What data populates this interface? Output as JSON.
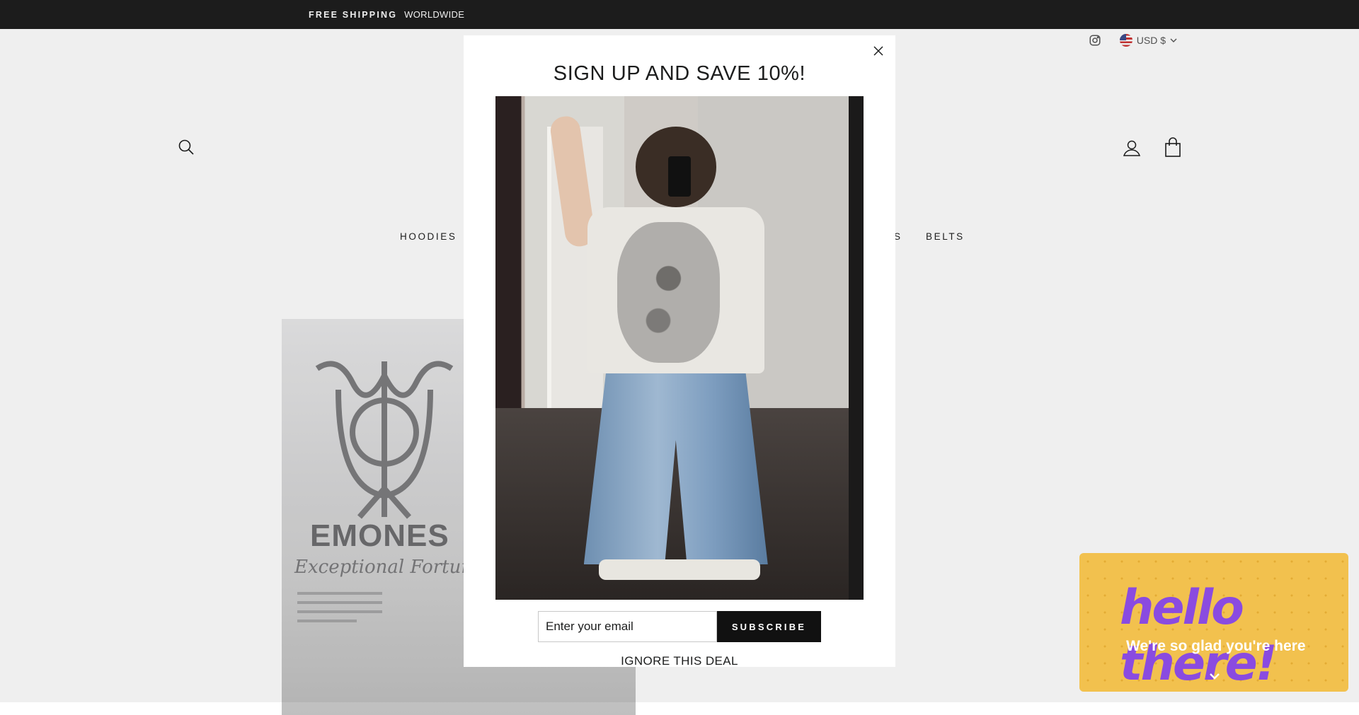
{
  "announcement": {
    "strong": "FREE SHIPPING",
    "light": "WORLDWIDE"
  },
  "utility": {
    "currency": "USD $"
  },
  "nav": [
    {
      "label": "HOODIES"
    },
    {
      "label": "S"
    },
    {
      "label": "BELTS"
    }
  ],
  "hero": {
    "brand": "EMONES",
    "tagline": "Exceptional Fortunes"
  },
  "modal": {
    "title": "SIGN UP AND SAVE 10%!",
    "email_placeholder": "Enter your email",
    "subscribe_label": "SUBSCRIBE",
    "ignore_label": "IGNORE THIS DEAL"
  },
  "widget": {
    "title": "hello there!",
    "subtitle": "We're so glad you're here"
  },
  "colors": {
    "announcement_bg": "#1c1d1d",
    "widget_bg": "#f2c14e",
    "widget_title": "#8a4be0",
    "button_bg": "#111111"
  }
}
